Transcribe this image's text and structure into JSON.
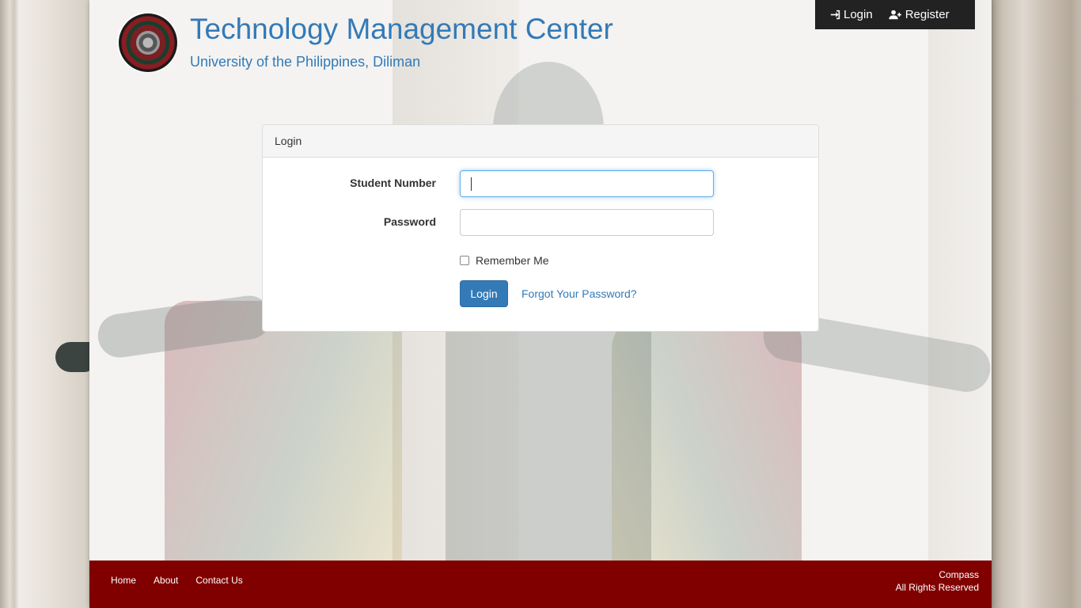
{
  "header": {
    "title": "Technology Management Center",
    "subtitle": "University of the Philippines, Diliman",
    "logo_icon": "university-seal-icon"
  },
  "topnav": {
    "login_label": "Login",
    "register_label": "Register",
    "login_icon": "sign-in-icon",
    "register_icon": "user-plus-icon"
  },
  "login_panel": {
    "heading": "Login",
    "student_number_label": "Student Number",
    "student_number_value": "",
    "password_label": "Password",
    "password_value": "",
    "remember_label": "Remember Me",
    "remember_checked": false,
    "submit_label": "Login",
    "forgot_label": "Forgot Your Password?"
  },
  "footer": {
    "links": [
      "Home",
      "About",
      "Contact Us"
    ],
    "brand": "Compass",
    "rights": "All Rights Reserved"
  },
  "colors": {
    "primary": "#337ab7",
    "footer_bg": "#800000",
    "nav_bg": "#222222"
  }
}
